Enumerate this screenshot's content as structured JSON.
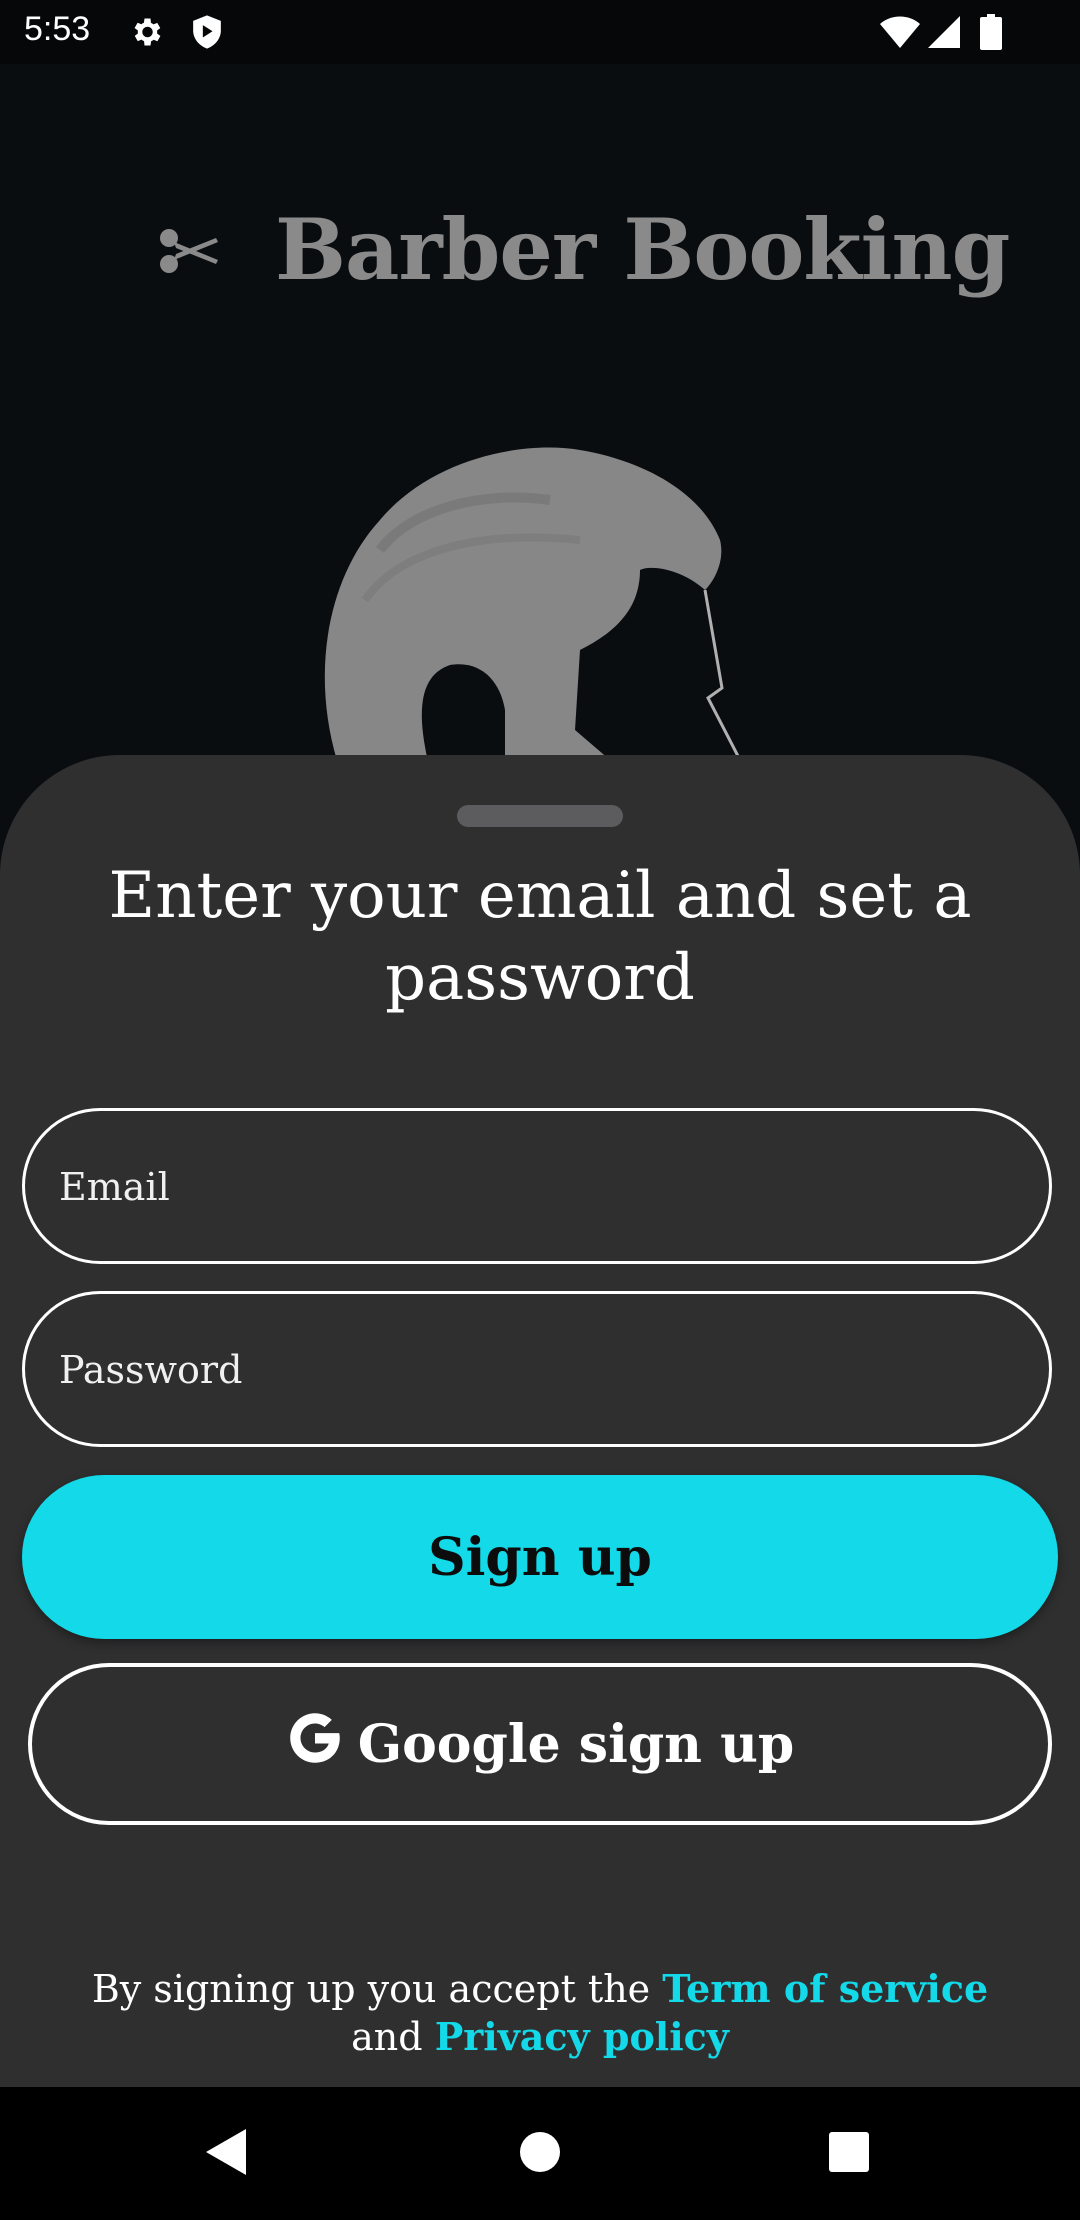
{
  "status_bar": {
    "time": "5:53",
    "icons": [
      "gear-icon",
      "shield-icon",
      "wifi-icon",
      "signal-icon",
      "battery-icon"
    ]
  },
  "header": {
    "title": "Barber Booking",
    "icon": "scissors-icon"
  },
  "sheet": {
    "title": "Enter your email and set a password",
    "email_placeholder": "Email",
    "password_placeholder": "Password",
    "signup_label": "Sign up",
    "google_label": "Google sign up",
    "terms_prefix": "By signing up you accept the",
    "terms_link": "Term of service",
    "terms_and": "and",
    "privacy_link": "Privacy policy"
  },
  "colors": {
    "accent": "#13d9e8",
    "sheet_bg": "#2f2f30",
    "page_bg": "#0a0d10"
  },
  "nav_bar": {
    "buttons": [
      "back-icon",
      "home-icon",
      "recents-icon"
    ]
  }
}
